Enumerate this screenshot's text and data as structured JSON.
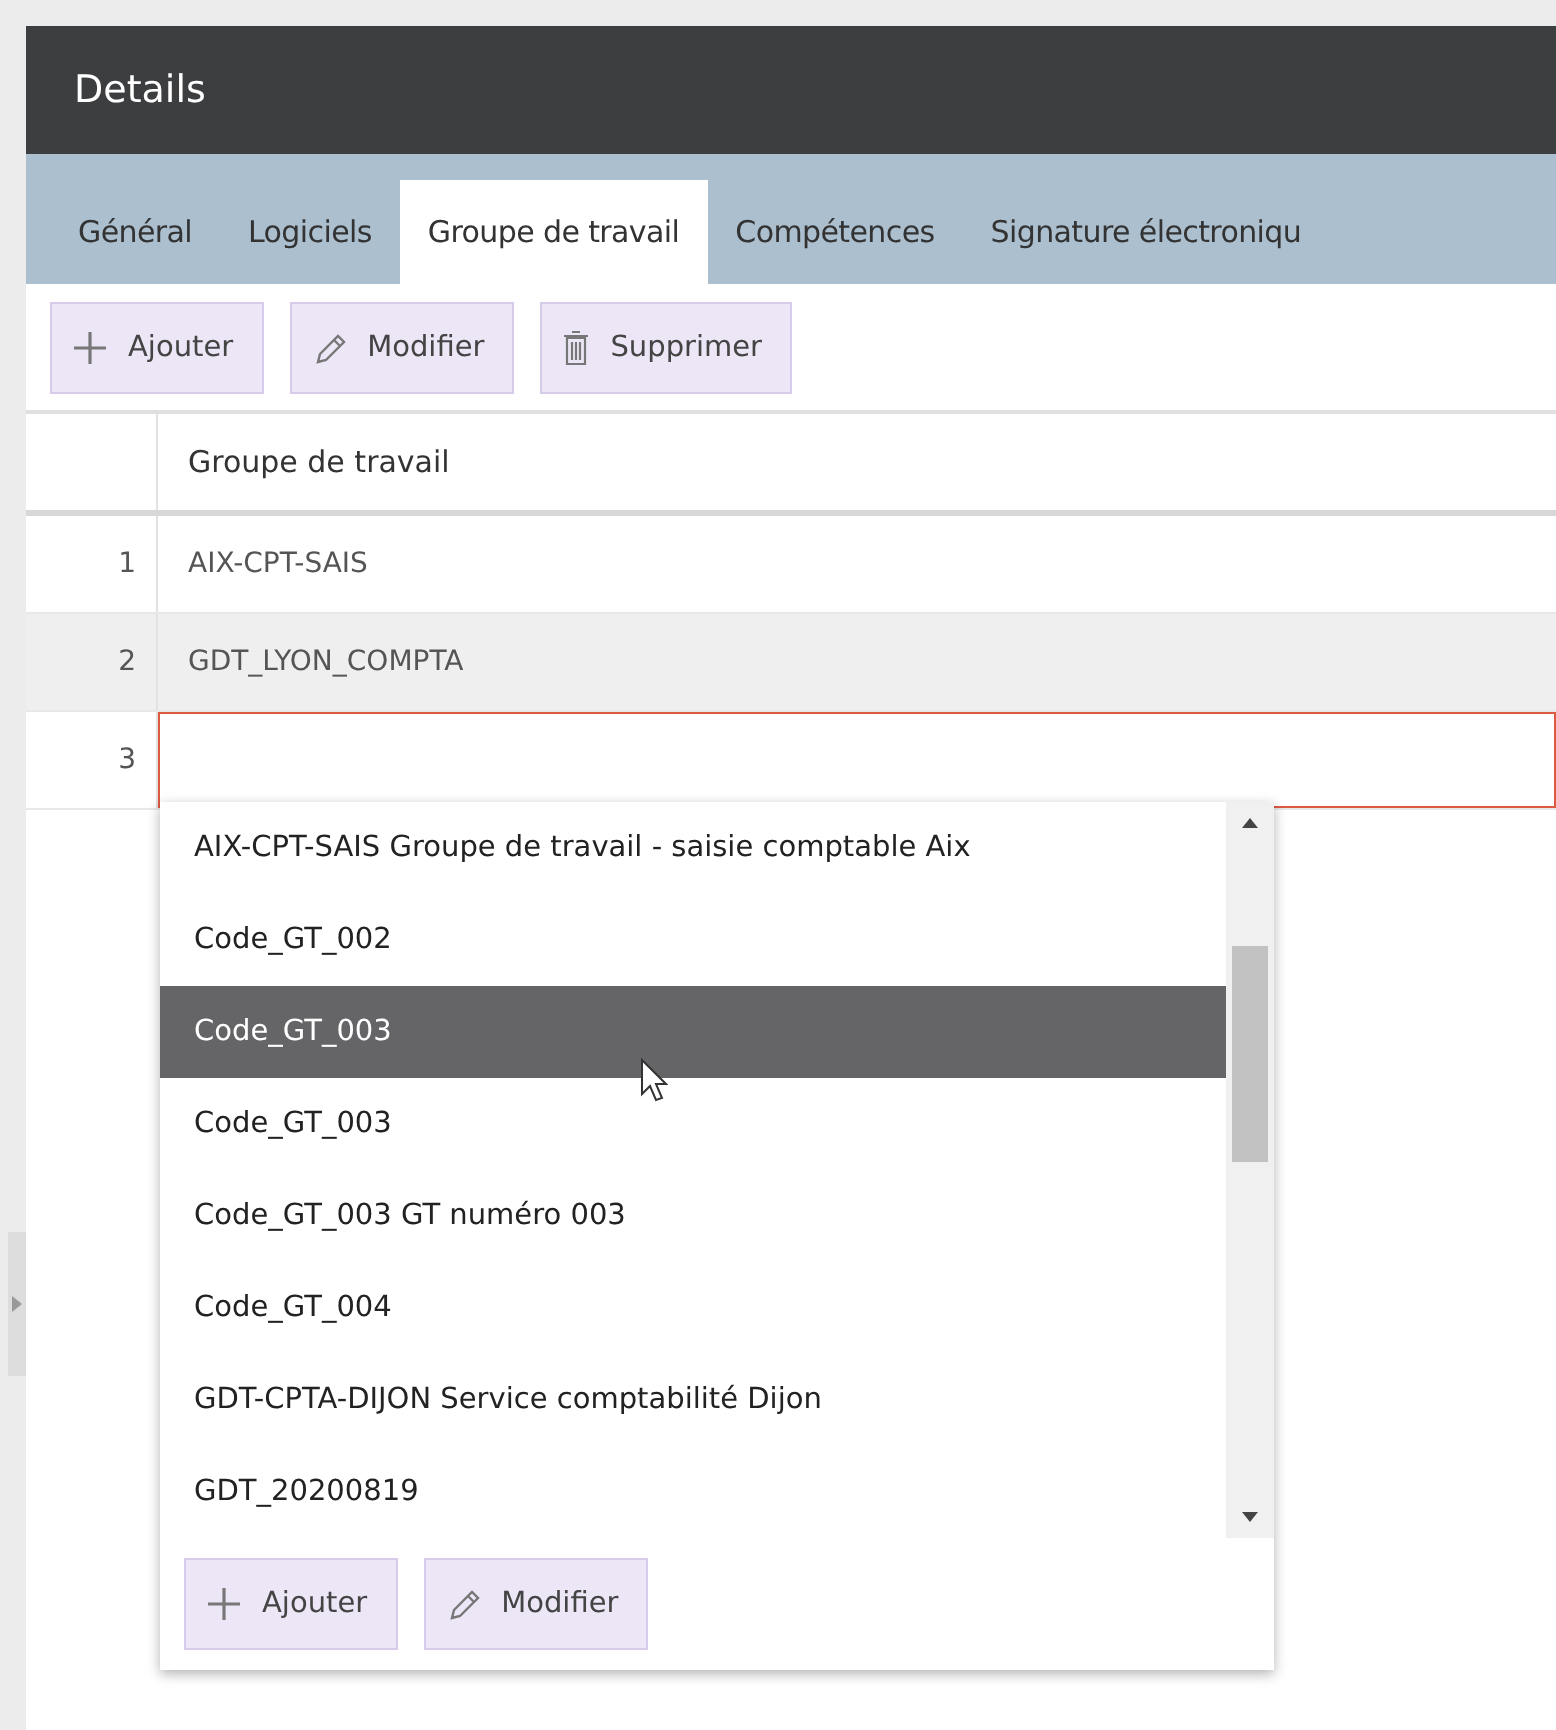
{
  "window": {
    "title": "Details"
  },
  "tabs": [
    {
      "label": "Général",
      "selected": false
    },
    {
      "label": "Logiciels",
      "selected": false
    },
    {
      "label": "Groupe de travail",
      "selected": true
    },
    {
      "label": "Compétences",
      "selected": false
    },
    {
      "label": "Signature électroniqu",
      "selected": false
    }
  ],
  "toolbar": [
    {
      "kind": "add",
      "label": "Ajouter"
    },
    {
      "kind": "edit",
      "label": "Modifier"
    },
    {
      "kind": "delete",
      "label": "Supprimer"
    }
  ],
  "table": {
    "columns": [
      "Groupe de travail"
    ],
    "rows": [
      {
        "number": "1",
        "kind": "text",
        "value": "AIX-CPT-SAIS",
        "highlighted": false
      },
      {
        "number": "2",
        "kind": "text",
        "value": "GDT_LYON_COMPTA",
        "highlighted": true
      },
      {
        "number": "3",
        "kind": "input",
        "value": "",
        "highlighted": false
      }
    ]
  },
  "dropdown": {
    "items": [
      {
        "label": "AIX-CPT-SAIS Groupe de travail - saisie comptable Aix",
        "selected": false
      },
      {
        "label": "Code_GT_002",
        "selected": false
      },
      {
        "label": "Code_GT_003",
        "selected": true
      },
      {
        "label": "Code_GT_003",
        "selected": false
      },
      {
        "label": "Code_GT_003 GT numéro 003",
        "selected": false
      },
      {
        "label": "Code_GT_004",
        "selected": false
      },
      {
        "label": "GDT-CPTA-DIJON Service comptabilité Dijon",
        "selected": false
      },
      {
        "label": "GDT_20200819",
        "selected": false
      }
    ],
    "buttons": [
      {
        "kind": "add",
        "label": "Ajouter"
      },
      {
        "kind": "edit",
        "label": "Modifier"
      }
    ]
  }
}
